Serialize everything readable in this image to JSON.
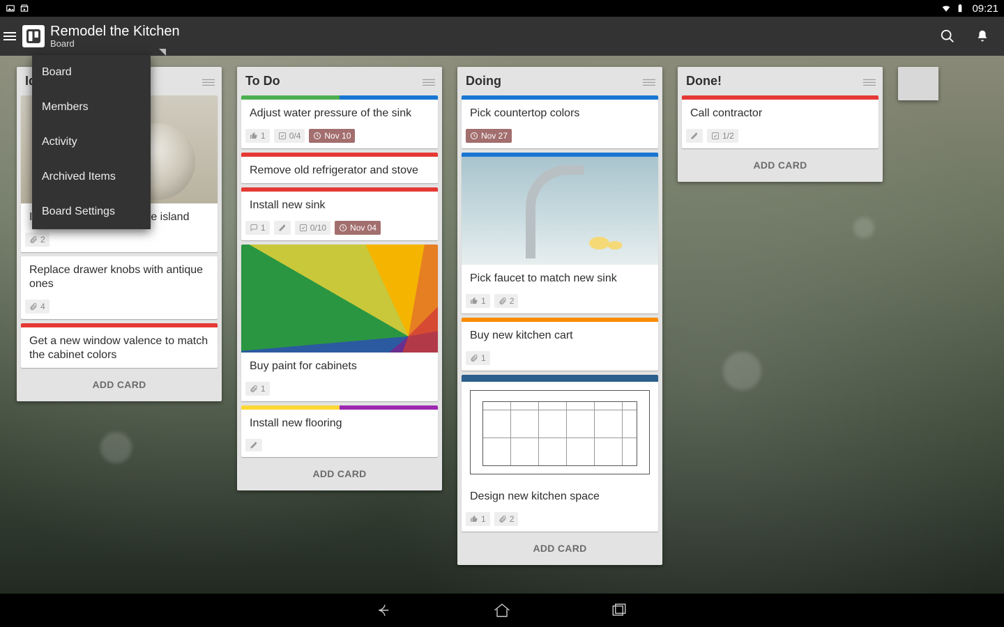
{
  "statusbar": {
    "time": "09:21"
  },
  "header": {
    "title": "Remodel the Kitchen",
    "subtitle": "Board"
  },
  "dropdown": {
    "items": [
      "Board",
      "Members",
      "Activity",
      "Archived Items",
      "Board Settings"
    ]
  },
  "labels": {
    "green": "#4caf50",
    "red": "#e53935",
    "yellow": "#fdd835",
    "purple": "#9c27b0",
    "blue": "#1976d2",
    "orange": "#fb8c00"
  },
  "lists": [
    {
      "title": "Ideas",
      "add": "ADD CARD",
      "cards": [
        {
          "title": "Install a pan rack over the island",
          "image": "pans",
          "badges": [
            {
              "icon": "paperclip",
              "text": "2"
            }
          ]
        },
        {
          "title": "Replace drawer knobs with antique ones",
          "badges": [
            {
              "icon": "paperclip",
              "text": "4"
            }
          ]
        },
        {
          "title": "Get a new window valence to match the cabinet colors",
          "labels": [
            "red"
          ],
          "badges": []
        }
      ]
    },
    {
      "title": "To Do",
      "add": "ADD CARD",
      "cards": [
        {
          "title": "Adjust water pressure of the sink",
          "labels": [
            "green",
            "blue"
          ],
          "badges": [
            {
              "icon": "thumb",
              "text": "1"
            },
            {
              "icon": "check",
              "text": "0/4"
            },
            {
              "icon": "clock",
              "text": "Nov 10",
              "due": true
            }
          ]
        },
        {
          "title": "Remove old refrigerator and stove",
          "labels": [
            "red"
          ],
          "badges": []
        },
        {
          "title": "Install new sink",
          "labels": [
            "red"
          ],
          "badges": [
            {
              "icon": "comment",
              "text": "1"
            },
            {
              "icon": "pencil",
              "text": ""
            },
            {
              "icon": "check",
              "text": "0/10"
            },
            {
              "icon": "clock",
              "text": "Nov 04",
              "due": true
            }
          ]
        },
        {
          "title": "Buy paint for cabinets",
          "image": "swatch",
          "badges": [
            {
              "icon": "paperclip",
              "text": "1"
            }
          ]
        },
        {
          "title": "Install new flooring",
          "labels": [
            "yellow",
            "purple"
          ],
          "badges": [
            {
              "icon": "pencil",
              "text": ""
            }
          ]
        }
      ]
    },
    {
      "title": "Doing",
      "add": "ADD CARD",
      "cards": [
        {
          "title": "Pick countertop colors",
          "labels": [
            "blue"
          ],
          "badges": [
            {
              "icon": "clock",
              "text": "Nov 27",
              "due": true
            }
          ]
        },
        {
          "title": "Pick faucet to match new sink",
          "labels": [
            "blue"
          ],
          "image": "faucet",
          "badges": [
            {
              "icon": "thumb",
              "text": "1"
            },
            {
              "icon": "paperclip",
              "text": "2"
            }
          ]
        },
        {
          "title": "Buy new kitchen cart",
          "labels": [
            "orange"
          ],
          "badges": [
            {
              "icon": "paperclip",
              "text": "1"
            }
          ]
        },
        {
          "title": "Design new kitchen space",
          "image": "plan",
          "badges": [
            {
              "icon": "thumb",
              "text": "1"
            },
            {
              "icon": "paperclip",
              "text": "2"
            }
          ]
        }
      ]
    },
    {
      "title": "Done!",
      "add": "ADD CARD",
      "cards": [
        {
          "title": "Call contractor",
          "labels": [
            "red"
          ],
          "badges": [
            {
              "icon": "pencil",
              "text": ""
            },
            {
              "icon": "check",
              "text": "1/2"
            }
          ]
        }
      ]
    }
  ]
}
